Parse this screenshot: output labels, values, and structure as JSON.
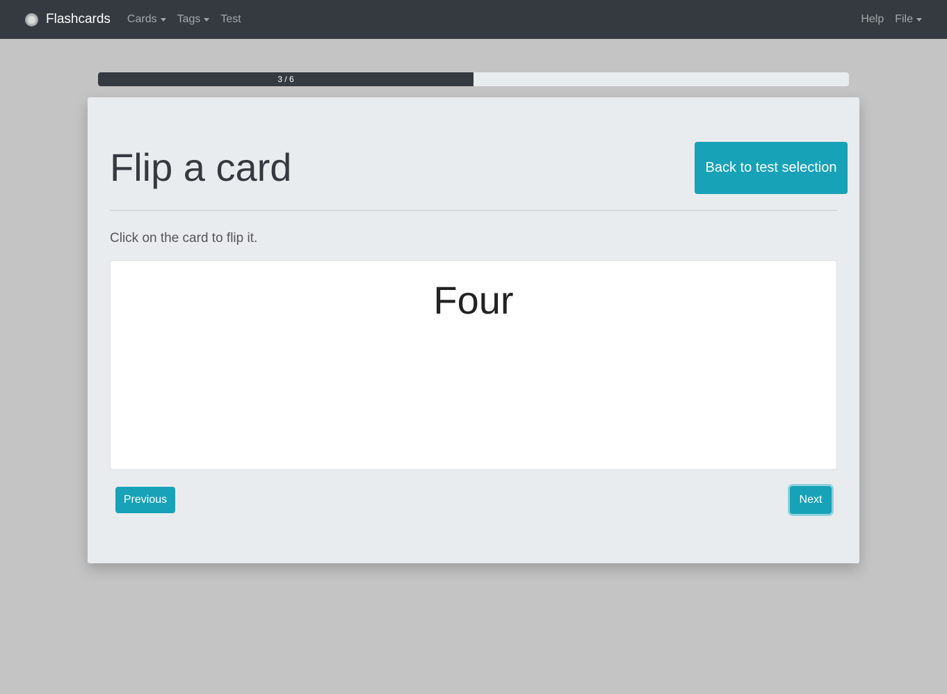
{
  "navbar": {
    "brand": "Flashcards",
    "items": [
      "Cards",
      "Tags",
      "Test"
    ],
    "right": [
      "Help",
      "File"
    ]
  },
  "progress": {
    "label": "3 / 6",
    "current": 3,
    "total": 6,
    "percent": 50
  },
  "page": {
    "title": "Flip a card",
    "back_button": "Back to test selection",
    "hint": "Click on the card to flip it.",
    "card_text": "Four",
    "previous": "Previous",
    "next": "Next"
  }
}
